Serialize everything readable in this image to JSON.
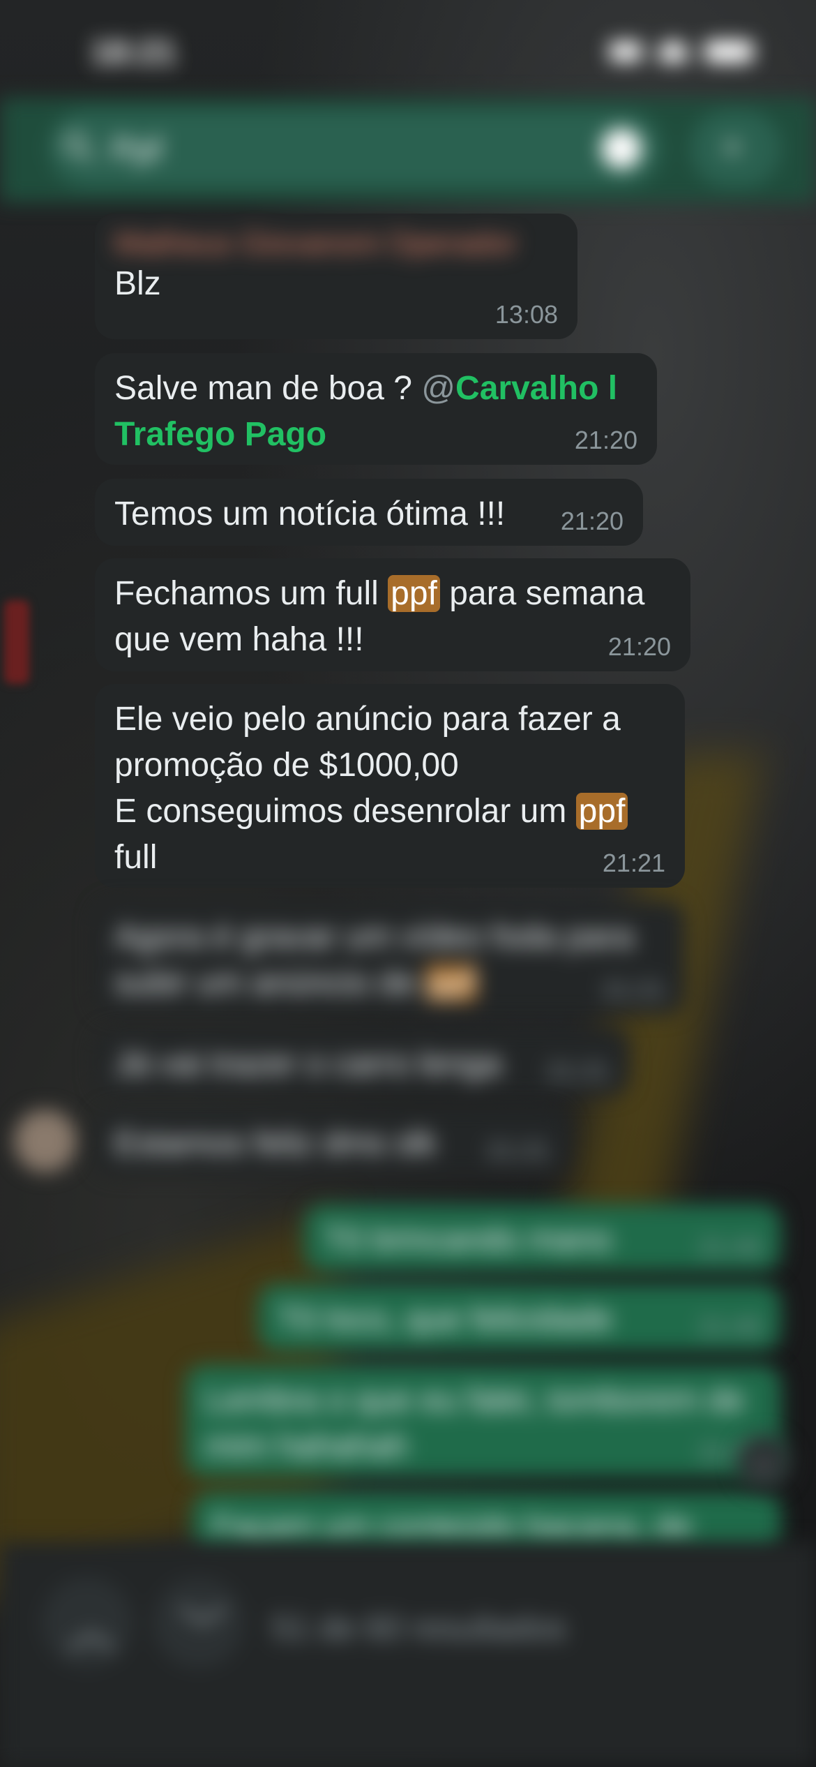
{
  "status_bar": {
    "time": "18:21"
  },
  "search": {
    "query": "Ppf"
  },
  "messages": [
    {
      "sender": "Matheus Giovanoni Operador",
      "text": "Blz",
      "time": "13:08"
    },
    {
      "text_before": "Salve man de boa ? ",
      "mention": "@Carvalho l Trafego Pago",
      "mention_at": "@",
      "mention_name": "Carvalho l",
      "mention_name_2": "Trafego Pago",
      "time": "21:20"
    },
    {
      "text": "Temos um notícia ótima !!!",
      "time": "21:20"
    },
    {
      "text_before": "Fechamos um full ",
      "highlight": "ppf",
      "text_after": " para semana",
      "line2": "que vem haha !!!",
      "time": "21:20"
    },
    {
      "line1": "Ele veio pelo anúncio para fazer a",
      "line2": "promoção de $1000,00",
      "line3_before": "E conseguimos desenrolar um ",
      "highlight": "ppf",
      "line4": "full",
      "time": "21:21"
    },
    {
      "line1": "Agora é gravar um vídeo foda para",
      "line2_before": "subir um anúncio de ",
      "highlight": "ppf",
      "time": "21:21"
    },
    {
      "text": "Já vai trazer o carro lenga",
      "time": "21:21"
    },
    {
      "text": "Estamos feliz dms slk",
      "time": "21:21"
    }
  ],
  "outgoing": [
    {
      "text": "Tô brincando mano",
      "time": "21:46"
    },
    {
      "text": "Tô loco, que felicidade",
      "time": "21:46"
    },
    {
      "line1": "Lembra o que eu falei, tomborem de",
      "line2": "mim hahahah",
      "time": "21:47"
    },
    {
      "text": "Façam um conteúdo bacana, de"
    }
  ],
  "bottom": {
    "results": "51 de 60 resultados",
    "up_icon": "chevron-up",
    "down_icon": "chevron-down"
  },
  "colors": {
    "header": "#1f4d3c",
    "bubble_in": "#232627",
    "bubble_out": "#1f6b4a",
    "mention": "#21c063",
    "highlight": "#a86d2a"
  }
}
